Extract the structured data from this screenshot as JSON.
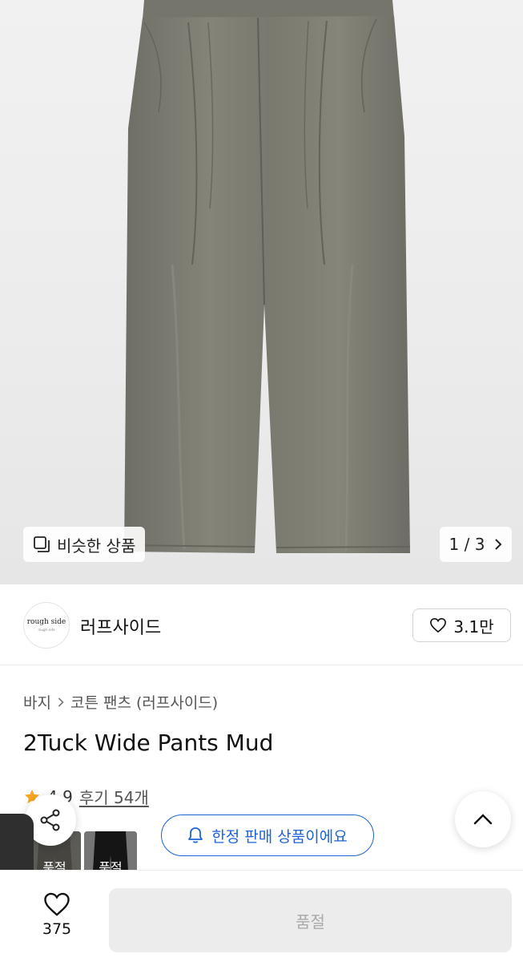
{
  "hero": {
    "similar_label": "비슷한 상품",
    "similar_icon": "similar-items-icon",
    "pager": {
      "current": "1",
      "separator": "/",
      "total": "3"
    }
  },
  "brand": {
    "logo_text": "rough side",
    "logo_subtext": "rough side",
    "name": "러프사이드",
    "like_count": "3.1만"
  },
  "breadcrumb": {
    "category": "바지",
    "subcategory": "코튼 팬츠 (러프사이드)"
  },
  "product": {
    "title": "2Tuck Wide Pants Mud",
    "rating": "4.9",
    "reviews": "후기 54개"
  },
  "thumbs": [
    {
      "label": "품절"
    },
    {
      "label": "품절"
    }
  ],
  "notice": {
    "text": "한정 판매 상품이에요"
  },
  "bottom": {
    "wish_count": "375",
    "buy_label": "품절"
  },
  "colors": {
    "accent_blue": "#1e63d6",
    "star": "#f5a623",
    "pants": "#7b7a72",
    "disabled_bg": "#ececec",
    "disabled_text": "#aaaaaa"
  }
}
